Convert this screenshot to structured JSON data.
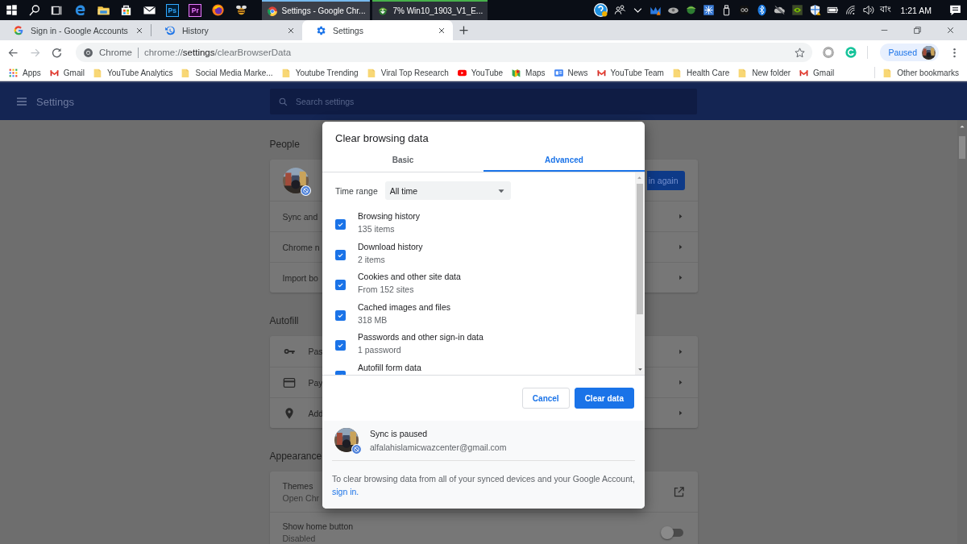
{
  "taskbar": {
    "apps": [
      {
        "kind": "start"
      },
      {
        "kind": "search"
      },
      {
        "kind": "taskview"
      },
      {
        "kind": "edge"
      },
      {
        "kind": "explorer"
      },
      {
        "kind": "store"
      },
      {
        "kind": "mail"
      },
      {
        "kind": "photoshop",
        "label": "Ps"
      },
      {
        "kind": "premiere",
        "label": "Pr"
      },
      {
        "kind": "firefox"
      },
      {
        "kind": "bee"
      }
    ],
    "windows": [
      {
        "title": "Settings - Google Chr...",
        "kind": "chrome",
        "selected": true
      },
      {
        "title": "7% Win10_1903_V1_E...",
        "kind": "download",
        "selected": false
      }
    ],
    "language": "বাং",
    "clock": "1:21 AM"
  },
  "browser_tabs": [
    {
      "title": "Sign in - Google Accounts",
      "kind": "google",
      "selected": false
    },
    {
      "title": "History",
      "kind": "history",
      "selected": false
    },
    {
      "title": "Settings",
      "kind": "settings",
      "selected": true
    }
  ],
  "toolbar": {
    "omnibox_label": "Chrome",
    "url_scheme": "chrome://",
    "url_host": "settings",
    "url_path": "/clearBrowserData",
    "profile_status": "Paused"
  },
  "bookmarks": [
    {
      "label": "Apps",
      "kind": "apps"
    },
    {
      "label": "Gmail",
      "kind": "gmail"
    },
    {
      "label": "YouTube Analytics",
      "kind": "folder"
    },
    {
      "label": "Social Media Marke...",
      "kind": "folder"
    },
    {
      "label": "Youtube Trending",
      "kind": "folder"
    },
    {
      "label": "Viral Top Research",
      "kind": "folder"
    },
    {
      "label": "YouTube",
      "kind": "youtube"
    },
    {
      "label": "Maps",
      "kind": "maps"
    },
    {
      "label": "News",
      "kind": "news"
    },
    {
      "label": "YouTube Team",
      "kind": "gmail"
    },
    {
      "label": "Health Care",
      "kind": "folder"
    },
    {
      "label": "New folder",
      "kind": "folder"
    },
    {
      "label": "Gmail",
      "kind": "gmail"
    }
  ],
  "other_bookmarks": "Other bookmarks",
  "settings": {
    "title": "Settings",
    "search_placeholder": "Search settings",
    "sections": [
      {
        "title": "People",
        "rows": [
          {
            "kind": "profile",
            "action": "in again"
          },
          {
            "kind": "link",
            "label": "Sync and"
          },
          {
            "kind": "link",
            "label": "Chrome n"
          },
          {
            "kind": "link",
            "label": "Import bo"
          }
        ]
      },
      {
        "title": "Autofill",
        "rows": [
          {
            "kind": "icon_link",
            "label": "Pas"
          },
          {
            "kind": "icon_link",
            "label": "Pay"
          },
          {
            "kind": "icon_link",
            "label": "Add"
          }
        ]
      },
      {
        "title": "Appearance",
        "rows": [
          {
            "kind": "external",
            "label": "Themes",
            "detail": "Open Chr"
          },
          {
            "kind": "toggle",
            "label": "Show home button",
            "detail": "Disabled",
            "on": false
          }
        ]
      }
    ]
  },
  "dialog": {
    "title": "Clear browsing data",
    "tabs": [
      {
        "label": "Basic",
        "selected": false
      },
      {
        "label": "Advanced",
        "selected": true
      }
    ],
    "time_range": {
      "label": "Time range",
      "value": "All time"
    },
    "items": [
      {
        "label": "Browsing history",
        "detail": "135 items",
        "checked": true
      },
      {
        "label": "Download history",
        "detail": "2 items",
        "checked": true
      },
      {
        "label": "Cookies and other site data",
        "detail": "From 152 sites",
        "checked": true
      },
      {
        "label": "Cached images and files",
        "detail": "318 MB",
        "checked": true
      },
      {
        "label": "Passwords and other sign-in data",
        "detail": "1 password",
        "checked": true
      },
      {
        "label": "Autofill form data",
        "checked": true
      }
    ],
    "cancel": "Cancel",
    "confirm": "Clear data",
    "account": {
      "status": "Sync is paused",
      "email": "alfalahislamicwazcenter@gmail.com"
    },
    "footer_text": "To clear browsing data from all of your synced devices and your Google Account,",
    "footer_link": "sign in."
  }
}
